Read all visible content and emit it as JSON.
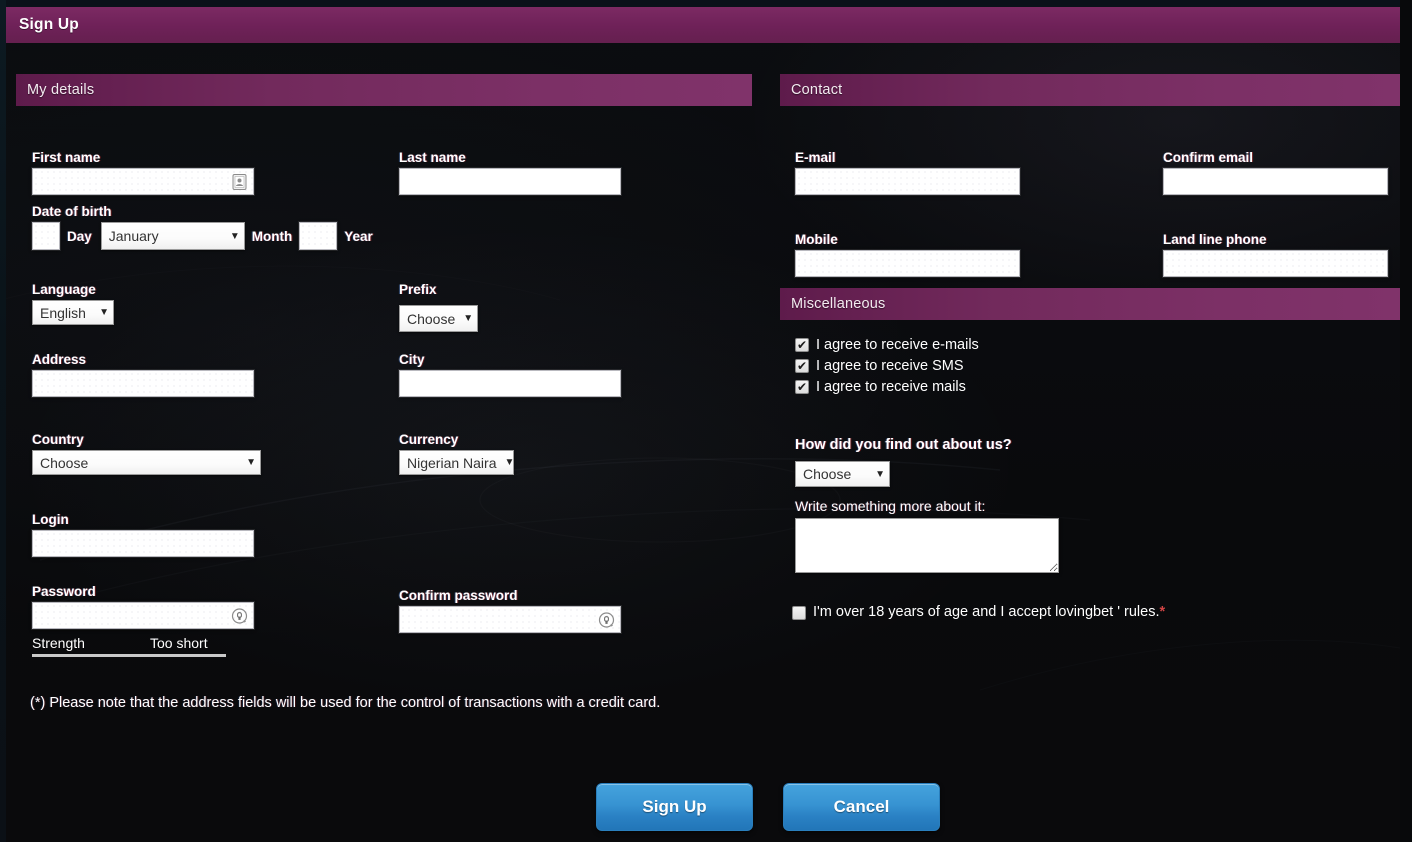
{
  "window": {
    "title": "Sign Up"
  },
  "theme": {
    "accent_purple": "#6e2158",
    "accent_purple_light": "#80336a",
    "button_blue": "#3793d2",
    "required_red": "#d14545",
    "page_bg": "#0a0b0e"
  },
  "sections": {
    "my_details": {
      "title": "My details"
    },
    "contact": {
      "title": "Contact"
    },
    "miscellaneous": {
      "title": "Miscellaneous"
    }
  },
  "my_details": {
    "first_name": {
      "label": "First name",
      "value": "",
      "icon": "contact-card-icon"
    },
    "last_name": {
      "label": "Last name",
      "value": ""
    },
    "date_of_birth": {
      "label": "Date of birth",
      "day": {
        "value": "",
        "label": "Day"
      },
      "month": {
        "value": "January",
        "label": "Month"
      },
      "year": {
        "value": "",
        "label": "Year"
      }
    },
    "language": {
      "label": "Language",
      "value": "English"
    },
    "prefix": {
      "label": "Prefix",
      "value": "Choose"
    },
    "address": {
      "label": "Address",
      "value": ""
    },
    "city": {
      "label": "City",
      "value": ""
    },
    "country": {
      "label": "Country",
      "value": "Choose"
    },
    "currency": {
      "label": "Currency",
      "value": "Nigerian Naira"
    },
    "login": {
      "label": "Login",
      "value": ""
    },
    "password": {
      "label": "Password",
      "value": "",
      "icon": "key-icon"
    },
    "confirm_password": {
      "label": "Confirm password",
      "value": "",
      "icon": "key-icon"
    },
    "strength": {
      "label": "Strength",
      "value": "Too short"
    }
  },
  "contact": {
    "email": {
      "label": "E-mail",
      "value": ""
    },
    "confirm_email": {
      "label": "Confirm email",
      "value": ""
    },
    "mobile": {
      "label": "Mobile",
      "value": ""
    },
    "land_line": {
      "label": "Land line phone",
      "value": ""
    }
  },
  "miscellaneous": {
    "consents": [
      {
        "label": "I agree to receive e-mails",
        "checked": true,
        "mark": "✔"
      },
      {
        "label": "I agree to receive SMS",
        "checked": true,
        "mark": "✔"
      },
      {
        "label": "I agree to receive mails",
        "checked": true,
        "mark": "✔"
      }
    ],
    "find_out": {
      "label": "How did you find out about us?",
      "value": "Choose"
    },
    "more_about": {
      "label": "Write something more about it:",
      "value": ""
    },
    "terms": {
      "text": "I'm over 18 years of age and I accept lovingbet ' rules.",
      "required_mark": "*",
      "checked": false
    }
  },
  "footer": {
    "note": "(*) Please note that the address fields will be used for the control of transactions with a credit card.",
    "signup_button": "Sign Up",
    "cancel_button": "Cancel"
  },
  "icons": {
    "dropdown_arrow": "▼"
  }
}
